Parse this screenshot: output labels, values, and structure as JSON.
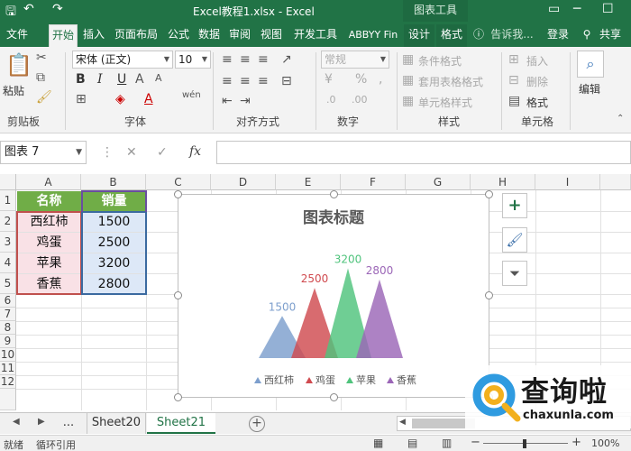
{
  "titlebar": {
    "document_title": "Excel教程1.xlsx - Excel",
    "context_header": "图表工具"
  },
  "tabs": [
    "文件",
    "开始",
    "插入",
    "页面布局",
    "公式",
    "数据",
    "审阅",
    "视图",
    "开发工具",
    "ABBYY Fin",
    "设计",
    "格式"
  ],
  "tab_active": "开始",
  "tell_me": "告诉我...",
  "sign_in": "登录",
  "share": "共享",
  "ribbon": {
    "clipboard": {
      "paste_label": "粘贴",
      "group": "剪贴板"
    },
    "font": {
      "font_name": "宋体 (正文)",
      "font_size": "10",
      "bold": "B",
      "italic": "I",
      "underline": "U",
      "group": "字体"
    },
    "alignment": {
      "group": "对齐方式"
    },
    "number": {
      "format": "常规",
      "percent": "%",
      "comma": ",",
      "group": "数字"
    },
    "styles": {
      "cond_format": "条件格式",
      "table_format": "套用表格格式",
      "cell_styles": "单元格样式",
      "group": "样式"
    },
    "cells": {
      "insert": "插入",
      "delete": "删除",
      "format": "格式",
      "group": "单元格"
    },
    "editing": {
      "label": "编辑"
    }
  },
  "formula_bar": {
    "name_box": "图表 7",
    "cancel": "✕",
    "enter": "✓",
    "fx": "fx",
    "value": ""
  },
  "columns": [
    "A",
    "B",
    "C",
    "D",
    "E",
    "F",
    "G",
    "H",
    "I"
  ],
  "rows": [
    "1",
    "2",
    "3",
    "4",
    "5",
    "6",
    "7",
    "8",
    "9",
    "10",
    "11",
    "12"
  ],
  "table": {
    "header": [
      "名称",
      "销量"
    ],
    "rows": [
      [
        "西红柿",
        "1500"
      ],
      [
        "鸡蛋",
        "2500"
      ],
      [
        "苹果",
        "3200"
      ],
      [
        "香蕉",
        "2800"
      ]
    ]
  },
  "chart_data": {
    "type": "bar",
    "title": "图表标题",
    "categories": [
      "西红柿",
      "鸡蛋",
      "苹果",
      "香蕉"
    ],
    "values": [
      1500,
      2500,
      3200,
      2800
    ],
    "data_labels": [
      "1500",
      "2500",
      "3200",
      "2800"
    ],
    "colors": [
      "#7d9fcd",
      "#d04a4f",
      "#4fc37c",
      "#9b66b7"
    ],
    "ylim": [
      0,
      3500
    ],
    "legend_position": "bottom",
    "grid": false
  },
  "sheets": {
    "nav_more": "...",
    "tabs": [
      "Sheet20",
      "Sheet21"
    ],
    "active": "Sheet21"
  },
  "status": {
    "mode": "就绪",
    "circular_ref": "循环引用",
    "zoom": "100%"
  },
  "watermark": {
    "text_cn": "查询啦",
    "text_url": "chaxunla.com"
  },
  "colors": {
    "brand": "#217346",
    "header_fill": "#70ad47",
    "name_fill": "#f9e1e6",
    "value_fill": "#dde8f7"
  }
}
